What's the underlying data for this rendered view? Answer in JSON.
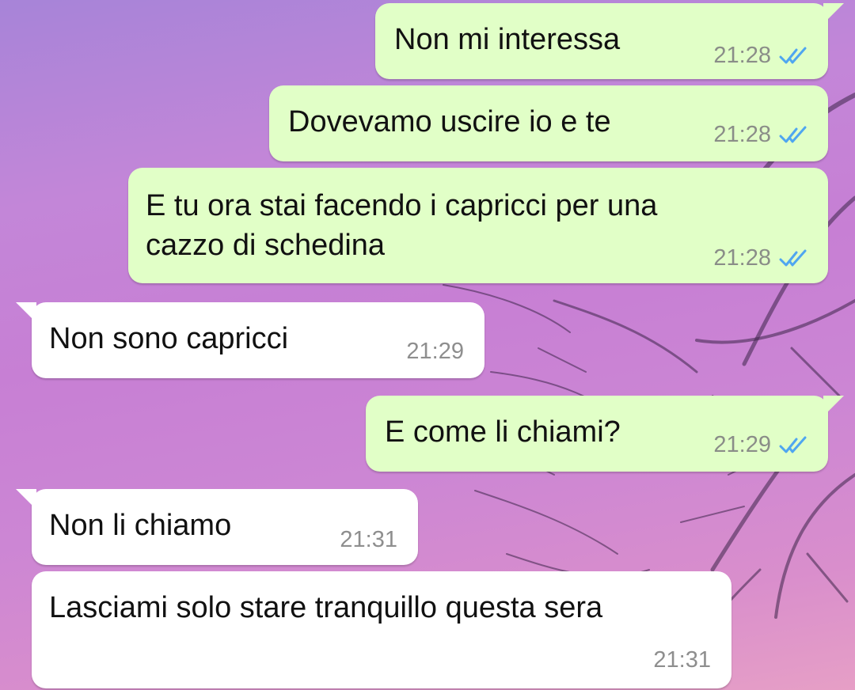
{
  "colors": {
    "outgoing_bubble": "#e1ffc7",
    "incoming_bubble": "#ffffff",
    "read_tick": "#4fa6f0",
    "timestamp": "#8a8d88"
  },
  "messages": [
    {
      "direction": "outgoing",
      "text": "Non mi interessa",
      "time": "21:28",
      "status": "read"
    },
    {
      "direction": "outgoing",
      "text": "Dovevamo uscire io e te",
      "time": "21:28",
      "status": "read"
    },
    {
      "direction": "outgoing",
      "text_lines": [
        "E tu ora stai facendo i capricci per una",
        "cazzo di schedina"
      ],
      "time": "21:28",
      "status": "read"
    },
    {
      "direction": "incoming",
      "text": "Non sono capricci",
      "time": "21:29"
    },
    {
      "direction": "outgoing",
      "text": "E come li chiami?",
      "time": "21:29",
      "status": "read"
    },
    {
      "direction": "incoming",
      "text": "Non li chiamo",
      "time": "21:31"
    },
    {
      "direction": "incoming",
      "text": "Lasciami solo stare tranquillo questa sera",
      "time": "21:31"
    }
  ]
}
